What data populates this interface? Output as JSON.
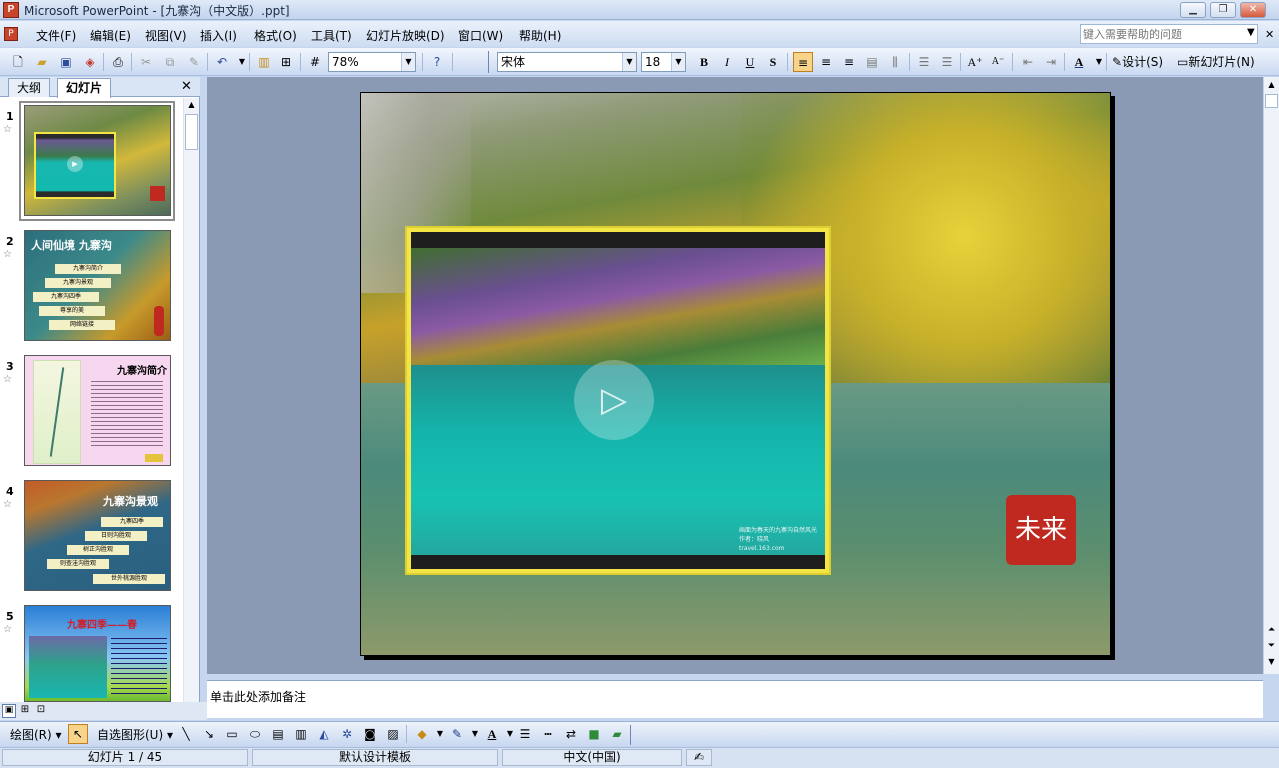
{
  "window": {
    "title": "Microsoft PowerPoint - [九寨沟（中文版）.ppt]"
  },
  "menu": [
    "文件(F)",
    "编辑(E)",
    "视图(V)",
    "插入(I)",
    "格式(O)",
    "工具(T)",
    "幻灯片放映(D)",
    "窗口(W)",
    "帮助(H)"
  ],
  "help_search": {
    "placeholder": "键入需要帮助的问题"
  },
  "toolbar": {
    "zoom": "78%",
    "font_name": "宋体",
    "font_size": "18",
    "design_label": "设计(S)",
    "new_slide_label": "新幻灯片(N)"
  },
  "panel": {
    "tabs": [
      "大纲",
      "幻灯片"
    ],
    "active_tab": "幻灯片",
    "slides": [
      {
        "num": "1"
      },
      {
        "num": "2",
        "title": "人间仙境  九寨沟",
        "buttons": [
          "九寨沟简介",
          "九寨沟景观",
          "九寨沟四季",
          "尊享的美",
          "网络链接"
        ]
      },
      {
        "num": "3",
        "title": "九寨沟简介"
      },
      {
        "num": "4",
        "title": "九寨沟景观",
        "buttons": [
          "九寨四季",
          "日则沟胜观",
          "树正沟胜观",
          "则查洼沟胜观",
          "世外桃源胜观"
        ]
      },
      {
        "num": "5",
        "title": "九寨四季——春"
      }
    ]
  },
  "slide": {
    "video_caption": [
      "画面为春天的九寨沟自然风光",
      "作者：晓风",
      "travel.163.com"
    ],
    "seal_text": "未来"
  },
  "notes": {
    "placeholder": "单击此处添加备注"
  },
  "drawing_toolbar": {
    "draw_label": "绘图(R)",
    "autoshapes_label": "自选图形(U)"
  },
  "status": {
    "slide_info": "幻灯片 1 / 45",
    "template": "默认设计模板",
    "language": "中文(中国)"
  },
  "colors": {
    "title_bar": "#c3d4ee",
    "slide_bg": "#8a9ab4",
    "accent": "#f3e545"
  }
}
